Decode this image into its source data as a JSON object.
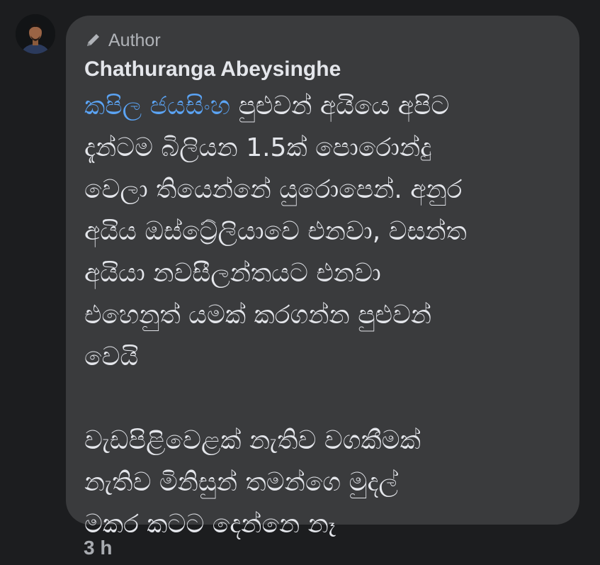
{
  "author": {
    "avatar_icon": "profile-avatar",
    "badge_icon": "pencil-icon",
    "badge_label": "Author",
    "name": "Chathuranga Abeysinghe"
  },
  "comment": {
    "mention": "කපිල ජයසිංහ",
    "first_line_rest": " පුළුවන් අයියෙ අපිට",
    "lines": [
      "දැන්ටම බිලියන 1.5ක් පොරොන්දු",
      "වෙලා තියෙන්නේ යුරොපෙන්. අනුර",
      "අයිය ඔස්ට්‍රේලියාවෙ එනවා, වසන්ත",
      "අයියා නවසීලන්තයට එනවා",
      "එහෙනුත් යමක් කරගන්න පුළුවන්",
      "වෙයි"
    ],
    "second_paragraph": [
      "වැඩපිළිවෙළක් නැතිව වගකීමක්",
      "නැතිව මිනිසුන් තමන්ගෙ මුදල්",
      "මකර කටට දෙන්නෙ නෑ"
    ]
  },
  "meta": {
    "timestamp": "3 h"
  },
  "colors": {
    "background": "#1c1d1f",
    "bubble": "#3a3b3d",
    "text": "#e4e6eb",
    "mention": "#5ba4f5",
    "secondary": "#b0b3b8"
  }
}
